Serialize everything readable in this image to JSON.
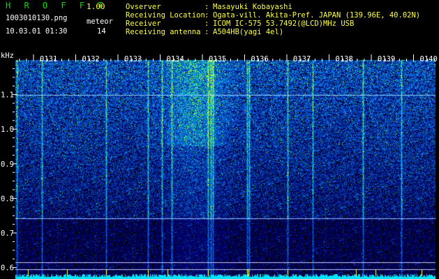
{
  "header": {
    "app_title": "H R O F F T",
    "version": "1.00",
    "filename": "1003010130.png",
    "mode_label": "meteor",
    "datetime": "10.03.01 01:30",
    "meteor_count": "14"
  },
  "station_info": {
    "labels": [
      "Ovserver",
      "Receiving Location",
      "Receiver",
      "Receiving antenna"
    ],
    "separator": ":",
    "values": [
      "Masayuki Kobayashi",
      "Ogata-vill. Akita-Pref. JAPAN (139.96E, 40.02N)",
      "ICOM IC-575 53.7492(@LCD)MHz USB",
      "A504HB(yagi 4el)"
    ]
  },
  "chart_data": {
    "type": "heatmap",
    "ylabel": "kHz",
    "y_ticks": [
      "1.1",
      "1.0",
      "0.9",
      "0.8",
      "0.7",
      "0.6"
    ],
    "x_ticks": [
      "0131",
      "0132",
      "0133",
      "0134",
      "0135",
      "0136",
      "0137",
      "0138",
      "0139",
      "0140"
    ],
    "ylim": [
      0.575,
      1.2
    ],
    "colors": {
      "background": "#000000",
      "low": "#000a8c",
      "mid": "#1f5cff",
      "high": "#20e060",
      "peak": "#ffff40",
      "horizontal_line": "#c8c8ff",
      "noise_floor": "#00e5ff"
    }
  }
}
